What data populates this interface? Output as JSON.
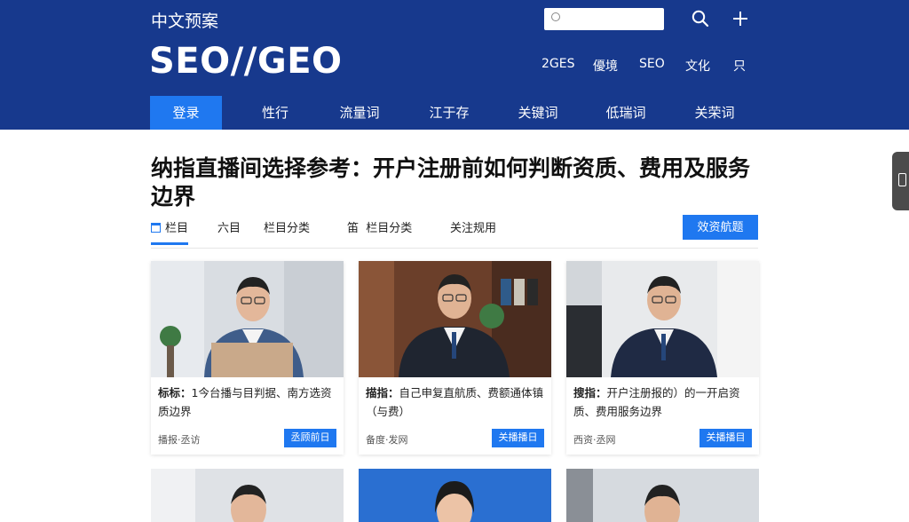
{
  "header": {
    "brand_small": "中文预案",
    "brand_big": "SEO//GEO",
    "search_placeholder": "",
    "top_links": [
      "2GES",
      "優境",
      "SEO",
      "文化",
      "只"
    ]
  },
  "nav": {
    "items": [
      {
        "label": "登录",
        "active": true
      },
      {
        "label": "性行",
        "active": false
      },
      {
        "label": "流量词",
        "active": false
      },
      {
        "label": "江于存",
        "active": false
      },
      {
        "label": "关键词",
        "active": false
      },
      {
        "label": "低瑞词",
        "active": false
      },
      {
        "label": "关荣词",
        "active": false
      }
    ]
  },
  "article": {
    "title": "纳指直播间选择参考：开户注册前如何判断资质、费用及服务边界",
    "tabs": [
      {
        "label": "栏目",
        "active": true
      },
      {
        "label": "六目",
        "active": false
      },
      {
        "label": "栏目分类",
        "active": false
      },
      {
        "label": "栏目分类",
        "prefix": "笛",
        "active": false
      },
      {
        "label": "关注规用",
        "active": false
      }
    ],
    "primary_button": "效资航题"
  },
  "cards": [
    {
      "title_prefix": "标标：",
      "title": "1今台播与目判据、南方选资质边界",
      "meta": "播报·丞访",
      "button": "丞顾前日"
    },
    {
      "title_prefix": "描指：",
      "title": "自己申复直航质、费额通体镇（与费）",
      "meta": "备度·发网",
      "button": "关播播日"
    },
    {
      "title_prefix": "搜指：",
      "title": "开户注册报的）的一开启资质、费用服务边界",
      "meta": "西资·丞网",
      "button": "关播播目"
    }
  ],
  "colors": {
    "header_bg": "#17398d",
    "accent": "#1f78f0"
  }
}
